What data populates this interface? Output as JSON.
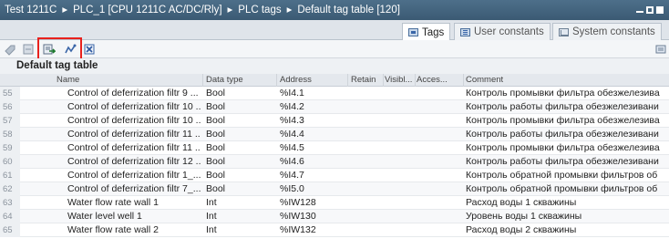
{
  "titlebar": {
    "crumbs": [
      "Test 1211C",
      "PLC_1 [CPU 1211C AC/DC/Rly]",
      "PLC tags",
      "Default tag table [120]"
    ],
    "separator": "▸"
  },
  "tabs": [
    {
      "label": "Tags",
      "icon": "tags-icon",
      "active": true
    },
    {
      "label": "User constants",
      "icon": "user-constants-icon",
      "active": false
    },
    {
      "label": "System constants",
      "icon": "system-constants-icon",
      "active": false
    }
  ],
  "toolbar": {
    "buttons": [
      "add-tag-icon",
      "insert-row-icon",
      "add-row-icon",
      "monitor-icon",
      "delete-icon"
    ]
  },
  "section_title": "Default tag table",
  "columns": {
    "name": "Name",
    "data_type": "Data type",
    "address": "Address",
    "retain": "Retain",
    "visible": "Visibl...",
    "accessible": "Acces...",
    "comment": "Comment"
  },
  "rows": [
    {
      "num": "55",
      "name": "Control of deferrization filtr 9 ...",
      "type": "Bool",
      "address": "%I4.1",
      "retain": false,
      "visible": true,
      "accessible": true,
      "comment": "Контроль промывки фильтра обезжелезива"
    },
    {
      "num": "56",
      "name": "Control of deferrization filtr 10 ...",
      "type": "Bool",
      "address": "%I4.2",
      "retain": false,
      "visible": true,
      "accessible": true,
      "comment": "Контроль работы фильтра обезжелезивани"
    },
    {
      "num": "57",
      "name": "Control of deferrization filtr 10 ...",
      "type": "Bool",
      "address": "%I4.3",
      "retain": false,
      "visible": true,
      "accessible": true,
      "comment": "Контроль промывки фильтра обезжелезива"
    },
    {
      "num": "58",
      "name": "Control of deferrization filtr 11 ...",
      "type": "Bool",
      "address": "%I4.4",
      "retain": false,
      "visible": true,
      "accessible": true,
      "comment": "Контроль работы фильтра обезжелезивани"
    },
    {
      "num": "59",
      "name": "Control of deferrization filtr 11 ...",
      "type": "Bool",
      "address": "%I4.5",
      "retain": false,
      "visible": true,
      "accessible": true,
      "comment": "Контроль промывки фильтра обезжелезива"
    },
    {
      "num": "60",
      "name": "Control of deferrization filtr 12 ...",
      "type": "Bool",
      "address": "%I4.6",
      "retain": false,
      "visible": true,
      "accessible": true,
      "comment": "Контроль работы фильтра обезжелезивани"
    },
    {
      "num": "61",
      "name": "Control of deferrization filtr 1_...",
      "type": "Bool",
      "address": "%I4.7",
      "retain": false,
      "visible": true,
      "accessible": true,
      "comment": "Контроль обратной промывки фильтров об"
    },
    {
      "num": "62",
      "name": "Control of deferrization filtr 7_...",
      "type": "Bool",
      "address": "%I5.0",
      "retain": false,
      "visible": true,
      "accessible": true,
      "comment": "Контроль обратной промывки фильтров об"
    },
    {
      "num": "63",
      "name": "Water flow rate wall 1",
      "type": "Int",
      "address": "%IW128",
      "retain": false,
      "visible": true,
      "accessible": true,
      "comment": "Расход воды 1 скважины"
    },
    {
      "num": "64",
      "name": "Water level well 1",
      "type": "Int",
      "address": "%IW130",
      "retain": false,
      "visible": true,
      "accessible": true,
      "comment": "Уровень воды 1 скважины"
    },
    {
      "num": "65",
      "name": "Water flow rate wall 2",
      "type": "Int",
      "address": "%IW132",
      "retain": false,
      "visible": true,
      "accessible": true,
      "comment": "Расход воды 2 скважины"
    }
  ]
}
